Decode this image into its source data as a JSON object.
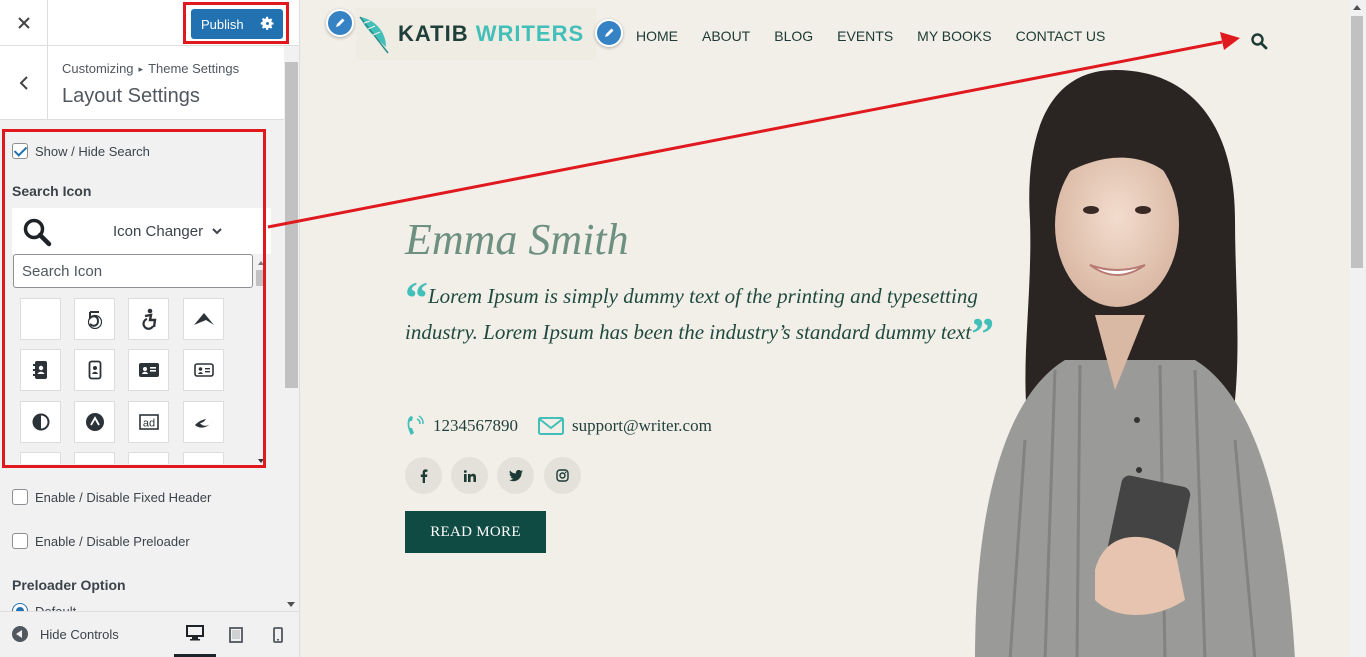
{
  "customizer": {
    "close_icon": "close-icon",
    "publish_label": "Publish",
    "breadcrumb": {
      "root": "Customizing",
      "parent": "Theme Settings"
    },
    "section_title": "Layout Settings",
    "show_hide_search": {
      "label": "Show / Hide Search",
      "checked": true
    },
    "search_icon_label": "Search Icon",
    "icon_changer": {
      "selected_icon": "search-icon",
      "label": "Icon Changer"
    },
    "search_icon_input": {
      "placeholder": "Search Icon",
      "value": ""
    },
    "icon_grid": [
      [
        "blank-icon",
        "500px-icon",
        "accessible-icon",
        "accusoft-icon"
      ],
      [
        "address-book-icon",
        "address-book-outline-icon",
        "address-card-icon",
        "address-card-outline-icon"
      ],
      [
        "adjust-icon",
        "adn-icon",
        "ad-icon",
        "adversal-icon"
      ]
    ],
    "fixed_header": {
      "label": "Enable / Disable Fixed Header",
      "checked": false
    },
    "preloader": {
      "label": "Enable / Disable Preloader",
      "checked": false
    },
    "preloader_option_label": "Preloader Option",
    "preloader_default": "Default",
    "hide_controls_label": "Hide Controls",
    "devices": [
      "desktop-icon",
      "tablet-icon",
      "mobile-icon"
    ]
  },
  "site": {
    "logo": {
      "part1": "KATIB",
      "part2": "WRITERS"
    },
    "nav": [
      "HOME",
      "ABOUT",
      "BLOG",
      "EVENTS",
      "MY BOOKS",
      "CONTACT US"
    ],
    "hero": {
      "name": "Emma Smith",
      "quote": "Lorem Ipsum is simply dummy text of the printing and typesetting industry. Lorem Ipsum has been the industry’s standard dummy text",
      "phone": "1234567890",
      "email": "support@writer.com",
      "socials": [
        "facebook-icon",
        "linkedin-icon",
        "twitter-icon",
        "instagram-icon"
      ],
      "button": "READ MORE"
    }
  },
  "colors": {
    "publish": "#2271b1",
    "annotation": "#e0191f",
    "accent_teal": "#42bfb8",
    "dark_green": "#0f4a43",
    "hero_bg": "#f2efe8"
  }
}
